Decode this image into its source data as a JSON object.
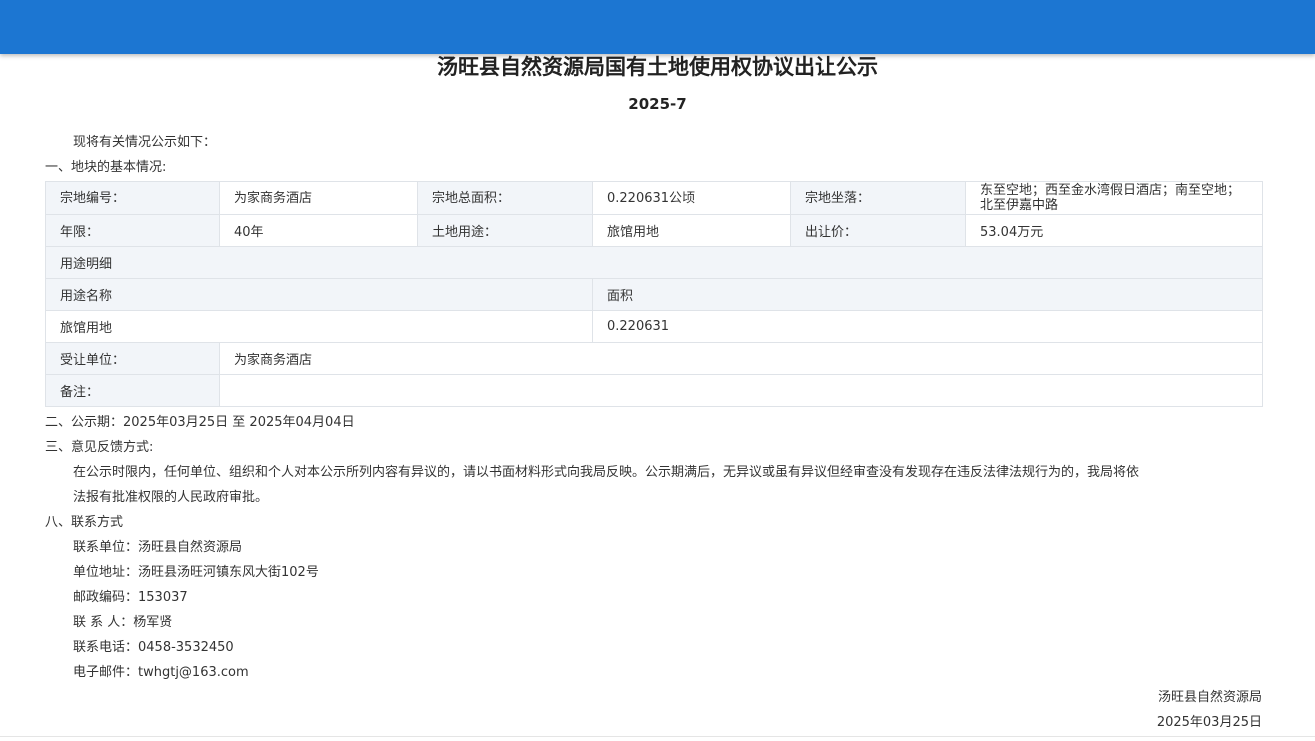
{
  "header": {
    "color": "#1c76d2"
  },
  "title": "汤旺县自然资源局国有土地使用权协议出让公示",
  "subtitle": "2025-7",
  "intro": "现将有关情况公示如下：",
  "section1": "一、地块的基本情况:",
  "table": {
    "parcel_no_label": "宗地编号：",
    "parcel_no_value": "为家商务酒店",
    "total_area_label": "宗地总面积：",
    "total_area_value": "0.220631公顷",
    "location_label": "宗地坐落：",
    "location_value": "东至空地；西至金水湾假日酒店；南至空地；北至伊嘉中路",
    "term_label": "年限：",
    "term_value": "40年",
    "land_use_label": "土地用途：",
    "land_use_value": "旅馆用地",
    "price_label": "出让价：",
    "price_value": "53.04万元",
    "use_detail_label": "用途明细",
    "use_name_header": "用途名称",
    "area_header": "面积",
    "use_name_value": "旅馆用地",
    "area_value": "0.220631",
    "assignee_label": "受让单位：",
    "assignee_value": "为家商务酒店",
    "remarks_label": "备注：",
    "remarks_value": ""
  },
  "section2": "二、公示期：2025年03月25日 至 2025年04月04日",
  "section3": "三、意见反馈方式:",
  "feedback_line1": "在公示时限内，任何单位、组织和个人对本公示所列内容有异议的，请以书面材料形式向我局反映。公示期满后，无异议或虽有异议但经审查没有发现存在违反法律法规行为的，我局将依",
  "feedback_line2": "法报有批准权限的人民政府审批。",
  "section8": "八、联系方式",
  "contact": {
    "unit": "联系单位：汤旺县自然资源局",
    "address": "单位地址：汤旺县汤旺河镇东风大街102号",
    "postcode": "邮政编码：153037",
    "person": "联 系 人：杨军贤",
    "phone": "联系电话：0458-3532450",
    "email": "电子邮件：twhgtj@163.com"
  },
  "signature": {
    "org": "汤旺县自然资源局",
    "date": "2025年03月25日"
  }
}
